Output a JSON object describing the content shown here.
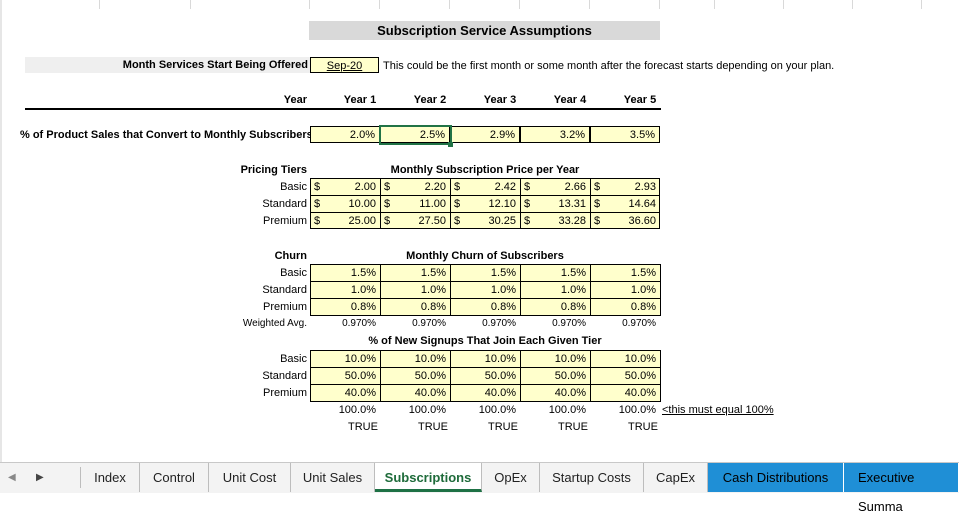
{
  "title": "Subscription Service Assumptions",
  "start": {
    "label": "Month Services Start Being Offered",
    "value": "Sep-20",
    "note": "This could be the first month or some month after the forecast starts depending on your plan."
  },
  "years": {
    "label": "Year",
    "list": [
      "Year 1",
      "Year 2",
      "Year 3",
      "Year 4",
      "Year 5"
    ]
  },
  "conversion": {
    "label": "% of Product Sales that Convert to Monthly Subscribers",
    "values": [
      "2.0%",
      "2.5%",
      "2.9%",
      "3.2%",
      "3.5%"
    ]
  },
  "pricing": {
    "label": "Pricing Tiers",
    "header": "Monthly Subscription Price per Year",
    "currency": "$",
    "rows": [
      {
        "tier": "Basic",
        "values": [
          "2.00",
          "2.20",
          "2.42",
          "2.66",
          "2.93"
        ]
      },
      {
        "tier": "Standard",
        "values": [
          "10.00",
          "11.00",
          "12.10",
          "13.31",
          "14.64"
        ]
      },
      {
        "tier": "Premium",
        "values": [
          "25.00",
          "27.50",
          "30.25",
          "33.28",
          "36.60"
        ]
      }
    ]
  },
  "churn": {
    "label": "Churn",
    "header": "Monthly Churn of Subscribers",
    "rows": [
      {
        "tier": "Basic",
        "values": [
          "1.5%",
          "1.5%",
          "1.5%",
          "1.5%",
          "1.5%"
        ]
      },
      {
        "tier": "Standard",
        "values": [
          "1.0%",
          "1.0%",
          "1.0%",
          "1.0%",
          "1.0%"
        ]
      },
      {
        "tier": "Premium",
        "values": [
          "0.8%",
          "0.8%",
          "0.8%",
          "0.8%",
          "0.8%"
        ]
      }
    ],
    "weighted_label": "Weighted Avg.",
    "weighted": [
      "0.970%",
      "0.970%",
      "0.970%",
      "0.970%",
      "0.970%"
    ]
  },
  "signups": {
    "header": "% of New Signups That Join Each Given Tier",
    "rows": [
      {
        "tier": "Basic",
        "values": [
          "10.0%",
          "10.0%",
          "10.0%",
          "10.0%",
          "10.0%"
        ]
      },
      {
        "tier": "Standard",
        "values": [
          "50.0%",
          "50.0%",
          "50.0%",
          "50.0%",
          "50.0%"
        ]
      },
      {
        "tier": "Premium",
        "values": [
          "40.0%",
          "40.0%",
          "40.0%",
          "40.0%",
          "40.0%"
        ]
      }
    ],
    "totals": [
      "100.0%",
      "100.0%",
      "100.0%",
      "100.0%",
      "100.0%"
    ],
    "total_note": "<this must equal 100%",
    "checks": [
      "TRUE",
      "TRUE",
      "TRUE",
      "TRUE",
      "TRUE"
    ]
  },
  "tabs": [
    "Index",
    "Control",
    "Unit Cost",
    "Unit Sales",
    "Subscriptions",
    "OpEx",
    "Startup Costs",
    "CapEx",
    "Cash Distributions",
    "Executive Summa"
  ],
  "active_tab": "Subscriptions",
  "colors": {
    "input_fill": "#ffffcc",
    "active_tab": "#1e7145",
    "blue_tab": "#1f8fd6"
  }
}
